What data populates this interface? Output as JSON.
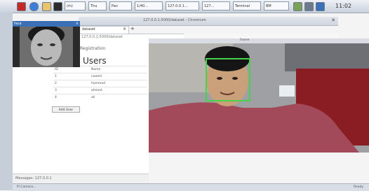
{
  "taskbar": {
    "buttons": [
      "(m)",
      "Thu",
      "Pan",
      "1/40...",
      "127.0.0.1...",
      "127...",
      "Terminal",
      "BM"
    ],
    "clock": "11:02"
  },
  "browser": {
    "window_title": "127.0.0.1:5000/dataset - Chromium",
    "tab_label": "dataset",
    "url": "127.0.0.1:5000/dataset",
    "video_label": "frame"
  },
  "thumbnail": {
    "title": "face"
  },
  "page": {
    "heading_small": "Registration",
    "title": "Users",
    "table": {
      "headers": [
        "ID",
        "Name"
      ],
      "rows": [
        [
          "1",
          "naeem"
        ],
        [
          "2",
          "hammad"
        ],
        [
          "3",
          "ahmed"
        ],
        [
          "4",
          "ali"
        ]
      ]
    },
    "button_label": "Add User"
  },
  "status": {
    "left": "Messages: 127.0.0.1",
    "bottom_text": "Pi Camera...",
    "right": "Ready"
  }
}
